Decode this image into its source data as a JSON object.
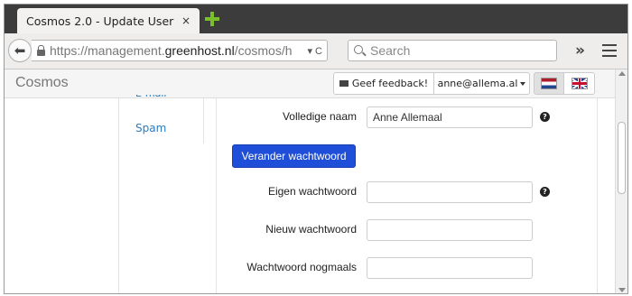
{
  "browser": {
    "tab_title": "Cosmos 2.0 - Update User",
    "tab_close": "×",
    "url_prefix": "https://management.",
    "url_domain": "greenhost.nl",
    "url_rest": "/cosmos/h",
    "url_controls": "▾ C",
    "search_placeholder": "Search",
    "overflow": "»"
  },
  "app": {
    "brand": "Cosmos",
    "feedback_label": "Geef feedback!",
    "user_label": "anne@allema.al",
    "languages": [
      "nl",
      "en"
    ]
  },
  "subnav": {
    "email_label": "E-mail",
    "spam_label": "Spam"
  },
  "form": {
    "full_name_label": "Volledige naam",
    "full_name_value": "Anne Allemaal",
    "change_password_button": "Verander wachtwoord",
    "current_password_label": "Eigen wachtwoord",
    "new_password_label": "Nieuw wachtwoord",
    "repeat_password_label": "Wachtwoord nogmaals",
    "help_glyph": "?"
  }
}
